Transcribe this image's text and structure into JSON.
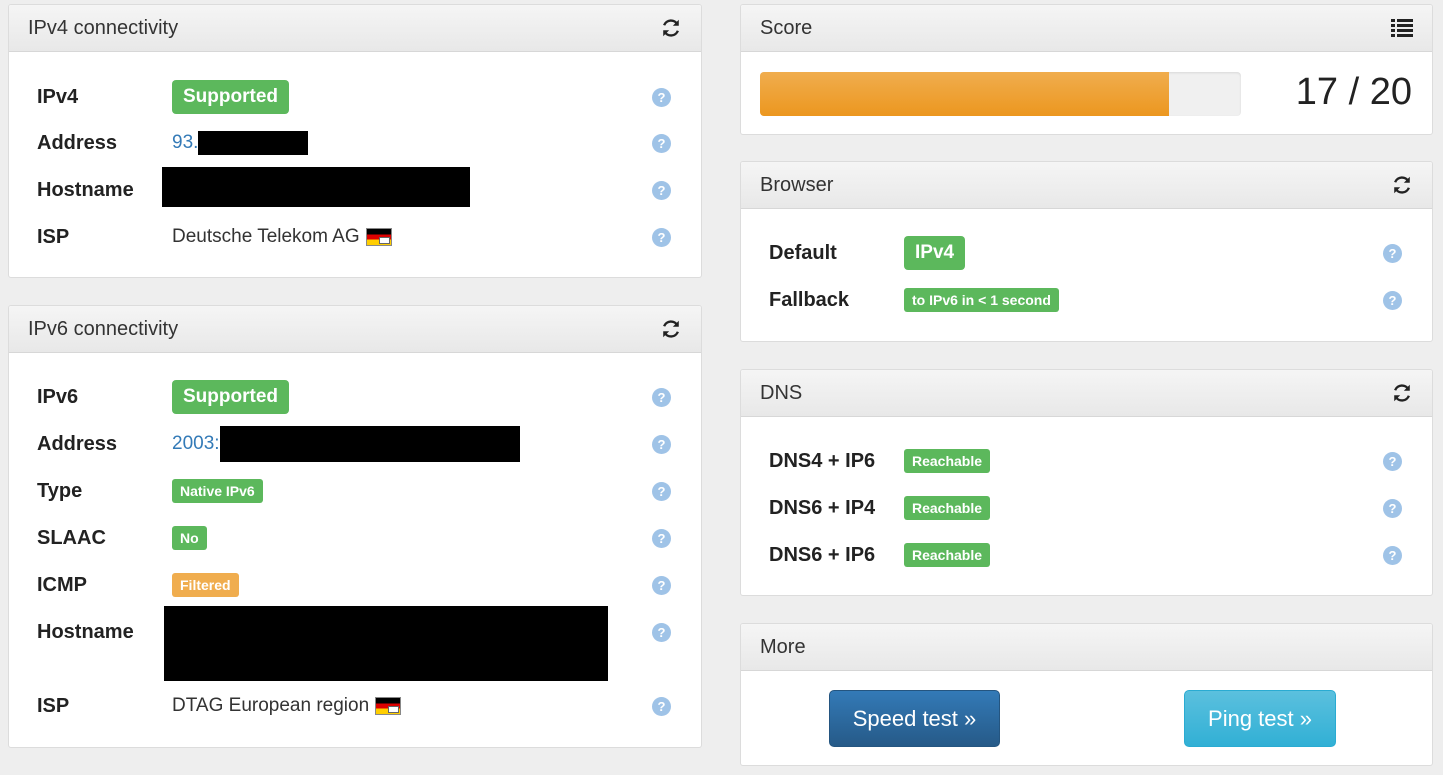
{
  "ipv4": {
    "title": "IPv4 connectivity",
    "rows": [
      {
        "label": "IPv4",
        "value": "Supported"
      },
      {
        "label": "Address",
        "value": "93."
      },
      {
        "label": "Hostname",
        "value": ""
      },
      {
        "label": "ISP",
        "value": "Deutsche Telekom AG"
      }
    ]
  },
  "ipv6": {
    "title": "IPv6 connectivity",
    "rows": [
      {
        "label": "IPv6",
        "value": "Supported"
      },
      {
        "label": "Address",
        "value": "2003:"
      },
      {
        "label": "Type",
        "value": "Native IPv6"
      },
      {
        "label": "SLAAC",
        "value": "No"
      },
      {
        "label": "ICMP",
        "value": "Filtered"
      },
      {
        "label": "Hostname",
        "value": ""
      },
      {
        "label": "ISP",
        "value": "DTAG European region"
      }
    ]
  },
  "score": {
    "title": "Score",
    "value": "17 / 20",
    "fraction": 0.85
  },
  "browser": {
    "title": "Browser",
    "rows": [
      {
        "label": "Default",
        "value": "IPv4"
      },
      {
        "label": "Fallback",
        "value": "to IPv6 in < 1 second"
      }
    ]
  },
  "dns": {
    "title": "DNS",
    "rows": [
      {
        "label": "DNS4 + IP6",
        "value": "Reachable"
      },
      {
        "label": "DNS6 + IP4",
        "value": "Reachable"
      },
      {
        "label": "DNS6 + IP6",
        "value": "Reachable"
      }
    ]
  },
  "more": {
    "title": "More",
    "speed_test": "Speed test »",
    "ping_test": "Ping test »"
  },
  "help_glyph": "?",
  "colors": {
    "success": "#5cb85c",
    "warning": "#f0ad4e",
    "progress": "#eea236",
    "primary": "#2e6da4",
    "info": "#31b0d5"
  }
}
